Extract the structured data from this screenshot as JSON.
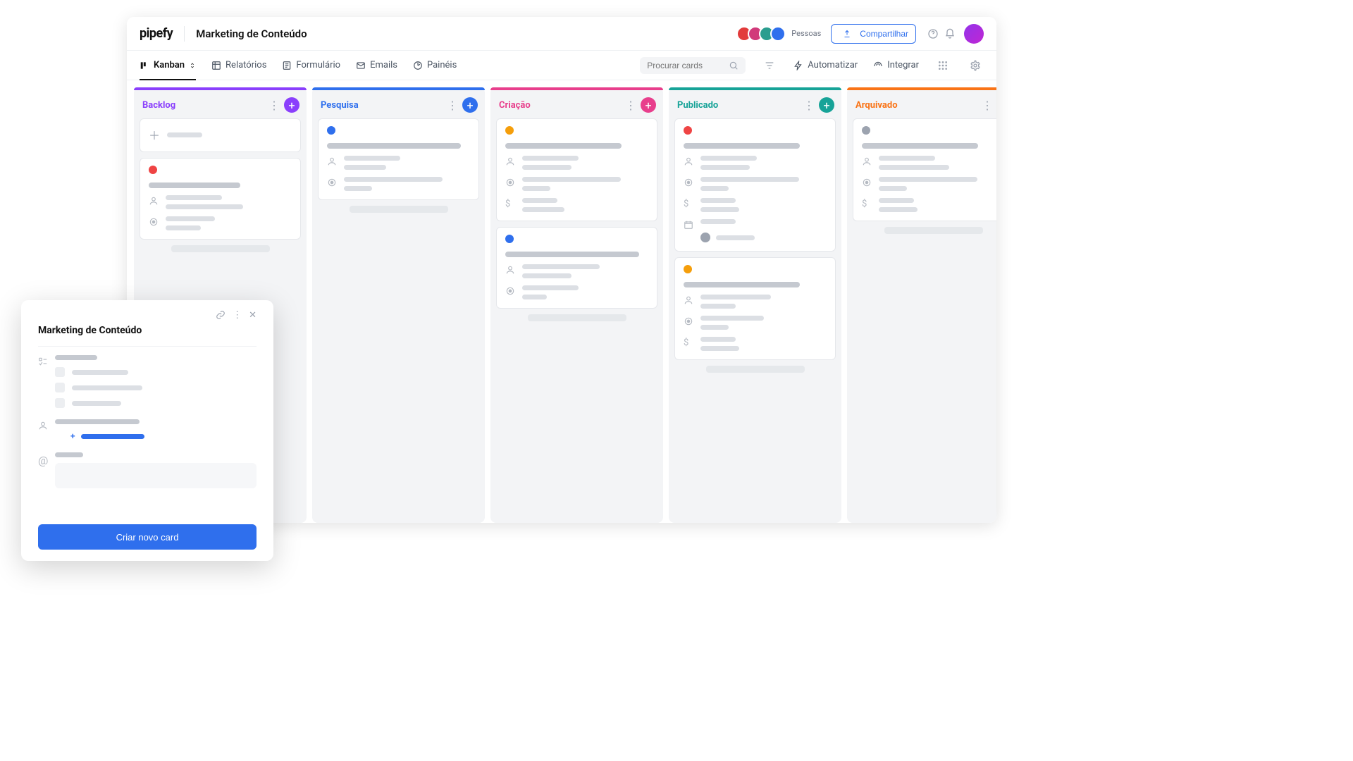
{
  "header": {
    "logo": "pipefy",
    "pipe_title": "Marketing de Conteúdo",
    "people_label": "Pessoas",
    "share_label": "Compartilhar"
  },
  "toolbar": {
    "tabs": [
      {
        "label": "Kanban",
        "icon": "kanban-icon",
        "active": true,
        "chevron": true
      },
      {
        "label": "Relatórios",
        "icon": "reports-icon"
      },
      {
        "label": "Formulário",
        "icon": "form-icon"
      },
      {
        "label": "Emails",
        "icon": "email-icon"
      },
      {
        "label": "Painéis",
        "icon": "dashboard-icon"
      }
    ],
    "search_placeholder": "Procurar cards",
    "automate_label": "Automatizar",
    "integrate_label": "Integrar"
  },
  "columns": [
    {
      "title": "Backlog",
      "color": "purple"
    },
    {
      "title": "Pesquisa",
      "color": "blue"
    },
    {
      "title": "Criação",
      "color": "pink"
    },
    {
      "title": "Publicado",
      "color": "teal"
    },
    {
      "title": "Arquivado",
      "color": "orange"
    }
  ],
  "form_panel": {
    "title": "Marketing de Conteúdo",
    "create_button": "Criar novo card"
  }
}
